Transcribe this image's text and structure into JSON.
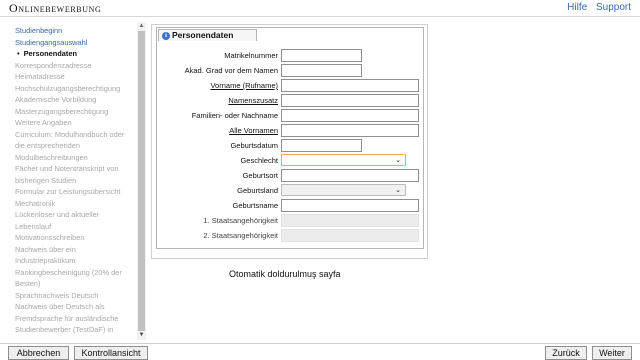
{
  "header": {
    "title": "Onlinebewerbung",
    "links": [
      {
        "label": "Hilfe"
      },
      {
        "label": "Support"
      }
    ]
  },
  "sidebar": {
    "items": [
      {
        "label": "Studienbeginn",
        "state": "link"
      },
      {
        "label": "Studiengangsauswahl",
        "state": "link"
      },
      {
        "label": "Personendaten",
        "state": "active"
      },
      {
        "label": "Korrespondenzadresse",
        "state": "disabled"
      },
      {
        "label": "Heimatadresse",
        "state": "disabled"
      },
      {
        "label": "Hochschulzugangsberechtigung",
        "state": "disabled"
      },
      {
        "label": "Akademische Vorbildung",
        "state": "disabled"
      },
      {
        "label": "Masterzugangsberechtigung",
        "state": "disabled"
      },
      {
        "label": "Weitere Angaben",
        "state": "disabled"
      },
      {
        "label": "Curriculum: Modulhandbuch oder",
        "state": "disabled"
      },
      {
        "label": "die entsprechenden",
        "state": "disabled"
      },
      {
        "label": "Modulbeschreibungen",
        "state": "disabled"
      },
      {
        "label": "Fächer und Notentranskript von",
        "state": "disabled"
      },
      {
        "label": "bisherigen Studien",
        "state": "disabled"
      },
      {
        "label": "Formular zur Leistungsübersicht",
        "state": "disabled"
      },
      {
        "label": "Mechatronik",
        "state": "disabled"
      },
      {
        "label": "Lückenloser und aktueller",
        "state": "disabled"
      },
      {
        "label": "Lebenslauf",
        "state": "disabled"
      },
      {
        "label": "Motivationsschreiben",
        "state": "disabled"
      },
      {
        "label": "Nachweis über ein",
        "state": "disabled"
      },
      {
        "label": "Industriepraktikum",
        "state": "disabled"
      },
      {
        "label": "Rankingbescheinigung (20% der",
        "state": "disabled"
      },
      {
        "label": "Besten)",
        "state": "disabled"
      },
      {
        "label": "Sprachnachweis Deutsch",
        "state": "disabled"
      },
      {
        "label": "Nachweis über Deutsch als",
        "state": "disabled"
      },
      {
        "label": "Fremdsprache für ausländische",
        "state": "disabled"
      },
      {
        "label": "Studienbewerber (TestDaF) in",
        "state": "disabled"
      }
    ],
    "scroll_up_icon": "triangle-up",
    "scroll_down_icon": "triangle-down"
  },
  "panel": {
    "title": "Personendaten",
    "info_icon": "i",
    "fields": [
      {
        "key": "matrikelnummer",
        "label": "Matrikelnummer",
        "type": "text",
        "size": "short",
        "underline": false,
        "value": ""
      },
      {
        "key": "akad-grad",
        "label": "Akad. Grad vor dem Namen",
        "type": "text",
        "size": "short",
        "underline": false,
        "value": ""
      },
      {
        "key": "vorname",
        "label": "Vorname (Rufname)",
        "type": "text",
        "size": "long",
        "underline": true,
        "value": ""
      },
      {
        "key": "namenszusatz",
        "label": "Namenszusatz",
        "type": "text",
        "size": "long",
        "underline": true,
        "value": ""
      },
      {
        "key": "nachname",
        "label": "Familien- oder Nachname",
        "type": "text",
        "size": "long",
        "underline": false,
        "value": ""
      },
      {
        "key": "alle-vornamen",
        "label": "Alle Vornamen",
        "type": "text",
        "size": "long",
        "underline": true,
        "value": ""
      },
      {
        "key": "geburtsdatum",
        "label": "Geburtsdatum",
        "type": "text",
        "size": "short",
        "underline": false,
        "value": ""
      },
      {
        "key": "geschlecht",
        "label": "Geschlecht",
        "type": "select",
        "size": "sel",
        "underline": false,
        "value": "",
        "focus": true
      },
      {
        "key": "geburtsort",
        "label": "Geburtsort",
        "type": "text",
        "size": "long",
        "underline": false,
        "value": ""
      },
      {
        "key": "geburtsland",
        "label": "Geburtsland",
        "type": "select",
        "size": "sel",
        "underline": false,
        "value": "",
        "disabled": true
      },
      {
        "key": "geburtsname",
        "label": "Geburtsname",
        "type": "text",
        "size": "long",
        "underline": false,
        "value": ""
      },
      {
        "key": "staatsangehoerigkeit-1",
        "label": "1. Staatsangehörigkeit",
        "type": "readonly",
        "size": "long",
        "underline": false,
        "value": ""
      },
      {
        "key": "staatsangehoerigkeit-2",
        "label": "2. Staatsangehörigkeit",
        "type": "readonly",
        "size": "long",
        "underline": false,
        "value": ""
      }
    ]
  },
  "note": "Otomatik doldurulmuş sayfa",
  "footer": {
    "abbrechen": "Abbrechen",
    "kontrollansicht": "Kontrollansicht",
    "zurueck": "Zurück",
    "weiter": "Weiter"
  }
}
